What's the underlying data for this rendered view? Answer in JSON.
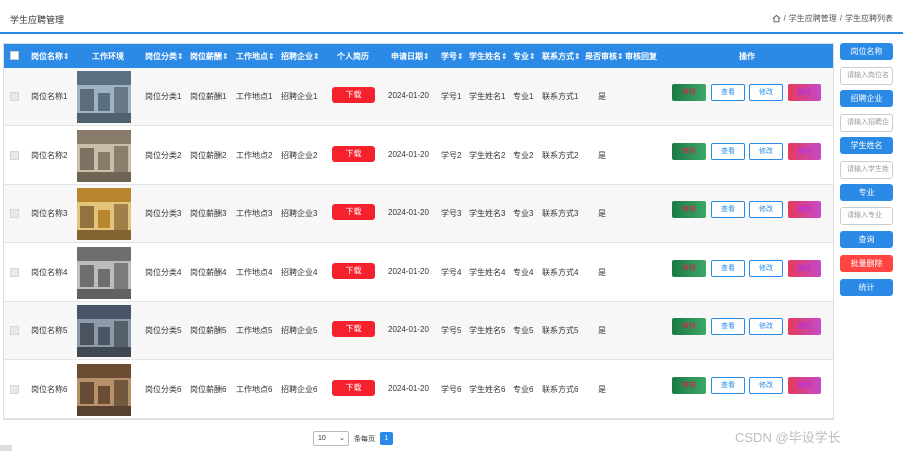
{
  "header": {
    "title": "学生应聘管理",
    "breadcrumb": [
      "学生应聘管理",
      "学生应聘列表"
    ],
    "home_icon": "home-icon"
  },
  "table": {
    "columns": [
      "岗位名称",
      "工作环境",
      "岗位分类",
      "岗位薪酬",
      "工作地点",
      "招聘企业",
      "个人简历",
      "申请日期",
      "学号",
      "学生姓名",
      "专业",
      "联系方式",
      "是否审核",
      "审核回复",
      "操作"
    ],
    "sortable_mark": "⇕",
    "row_buttons": {
      "download": "下载",
      "review": "审核",
      "view": "查看",
      "edit": "修改",
      "delete": "删除"
    },
    "rows": [
      {
        "name": "岗位名称1",
        "category": "岗位分类1",
        "salary": "岗位薪酬1",
        "location": "工作地点1",
        "company": "招聘企业1",
        "date": "2024-01-20",
        "student_id": "学号1",
        "student_name": "学生姓名1",
        "major": "专业1",
        "contact": "联系方式1",
        "reviewed": "是",
        "reply": ""
      },
      {
        "name": "岗位名称2",
        "category": "岗位分类2",
        "salary": "岗位薪酬2",
        "location": "工作地点2",
        "company": "招聘企业2",
        "date": "2024-01-20",
        "student_id": "学号2",
        "student_name": "学生姓名2",
        "major": "专业2",
        "contact": "联系方式2",
        "reviewed": "是",
        "reply": ""
      },
      {
        "name": "岗位名称3",
        "category": "岗位分类3",
        "salary": "岗位薪酬3",
        "location": "工作地点3",
        "company": "招聘企业3",
        "date": "2024-01-20",
        "student_id": "学号3",
        "student_name": "学生姓名3",
        "major": "专业3",
        "contact": "联系方式3",
        "reviewed": "是",
        "reply": ""
      },
      {
        "name": "岗位名称4",
        "category": "岗位分类4",
        "salary": "岗位薪酬4",
        "location": "工作地点4",
        "company": "招聘企业4",
        "date": "2024-01-20",
        "student_id": "学号4",
        "student_name": "学生姓名4",
        "major": "专业4",
        "contact": "联系方式4",
        "reviewed": "是",
        "reply": ""
      },
      {
        "name": "岗位名称5",
        "category": "岗位分类5",
        "salary": "岗位薪酬5",
        "location": "工作地点5",
        "company": "招聘企业5",
        "date": "2024-01-20",
        "student_id": "学号5",
        "student_name": "学生姓名5",
        "major": "专业5",
        "contact": "联系方式5",
        "reviewed": "是",
        "reply": ""
      },
      {
        "name": "岗位名称6",
        "category": "岗位分类6",
        "salary": "岗位薪酬6",
        "location": "工作地点6",
        "company": "招聘企业6",
        "date": "2024-01-20",
        "student_id": "学号6",
        "student_name": "学生姓名6",
        "major": "专业6",
        "contact": "联系方式6",
        "reviewed": "是",
        "reply": ""
      }
    ]
  },
  "sidebar": {
    "job_name_label": "岗位名称",
    "job_name_placeholder": "请输入岗位名",
    "company_label": "招聘企业",
    "company_placeholder": "请输入招聘企",
    "student_label": "学生姓名",
    "student_placeholder": "请输入学生姓",
    "major_label": "专业",
    "major_placeholder": "请输入专业",
    "search": "查询",
    "batch_delete": "批量删除",
    "stats": "统计"
  },
  "pager": {
    "page_size": "10",
    "per_page": "条每页",
    "current_page": "1"
  },
  "watermark": "CSDN @毕设学长",
  "colors": {
    "primary": "#2a8ae6",
    "danger": "#f5222d",
    "review_green": "#2e8f57"
  }
}
